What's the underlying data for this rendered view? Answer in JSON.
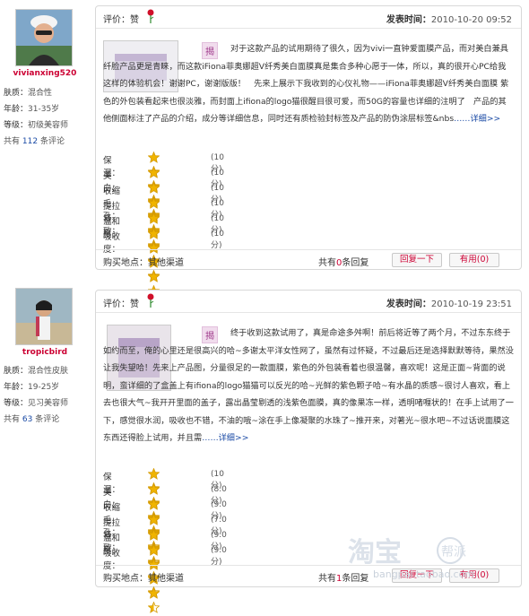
{
  "colors": {
    "accent": "#cc0033",
    "link": "#1a4aa5",
    "star": "#f0b400",
    "tag_bg": "#f1dced"
  },
  "reviews": [
    {
      "user": {
        "name": "vivianxing520",
        "skin_label": "肤质：",
        "skin": "混合性",
        "age_label": "年龄：",
        "age": "31-35岁",
        "level_label": "等级：",
        "level": "初级美容师",
        "count_prefix": "共有",
        "count": "112",
        "count_suffix": "条评论"
      },
      "rating_label": "评价：赞",
      "time_label": "发表时间：",
      "time": "2010-10-20 09:52",
      "tag": "揭",
      "text": "对于这款产品的试用期待了很久，因为vivi一直钟爱面膜产品，而对美白兼具纤脸产品更是青睐，而这款iFiona菲奥娜超V纤秀美白面膜真是集合多种心愿于一体，所以，真的很开心PC给我这样的体验机会！谢谢PC，谢谢版版！　先来上展示下我收到的心仪礼物——iFiona菲奥娜超V纤秀美白面膜 紫色的外包装看起来也很淡雅，而封面上ifiona的logo猫很醒目很可爱，而50G的容量也详细的注明了　产品的其他侧面标注了产品的介绍，成分等详细信息，同时还有质检验封标签及产品的防伪涂层标签&nbs",
      "more": "……详细>>",
      "ratings": [
        {
          "name": "保湿：",
          "stars": 5,
          "score": "(10分)"
        },
        {
          "name": "美白：",
          "stars": 5,
          "score": "(10分)"
        },
        {
          "name": "收缩毛孔：",
          "stars": 5,
          "score": "(10分)"
        },
        {
          "name": "提拉紧致：",
          "stars": 5,
          "score": "(10分)"
        },
        {
          "name": "温和度：",
          "stars": 5,
          "score": "(10分)"
        },
        {
          "name": "吸收度：",
          "stars": 5,
          "score": "(10分)"
        }
      ],
      "buy_place": "购买地点：其他渠道",
      "reply_prefix": "共有",
      "reply_count": "0",
      "reply_suffix": "条回复",
      "reply_btn": "回复一下",
      "useful_btn": "有用(0)"
    },
    {
      "user": {
        "name": "tropicbird",
        "skin_label": "肤质：",
        "skin": "混合性皮肤",
        "age_label": "年龄：",
        "age": "19-25岁",
        "level_label": "等级：",
        "level": "见习美容师",
        "count_prefix": "共有",
        "count": "63",
        "count_suffix": "条评论"
      },
      "rating_label": "评价：赞",
      "time_label": "发表时间：",
      "time": "2010-10-19 23:51",
      "tag": "揭",
      "text": "终于收到这款试用了，真是命途多舛啊！前后将近等了两个月，不过东东终于如约而至，俺的心里还是很高兴的哈~多谢太平洋女性网了，虽然有过怀疑，不过最后还是选择默默等待，果然没让我失望哈！先来上产品图，分量很足的一款面膜，紫色的外包装看着也很温馨，喜欢呢！这是正面~背面的说明，蛮详细的了盒盖上有ifiona的logo猫猫可以反光的哈~光鲜的紫色颗子哈~有水晶的质感~很讨人喜欢，看上去也很大气~我开开里面的盖子，露出晶莹剔透的浅紫色面膜，真的像果冻一样，透明啫喱状的！在手上试用了一下，感觉很水润，吸收也不错，不油的哦~涂在手上像凝聚的水珠了~推开来，对著光~很水吧~不过话说面膜这东西还得脸上试用，并且需",
      "more": "……详细>>",
      "ratings": [
        {
          "name": "保湿：",
          "stars": 5,
          "score": "(10分)"
        },
        {
          "name": "美白：",
          "stars": 4,
          "score": "(8.0分)"
        },
        {
          "name": "收缩毛孔：",
          "stars": 4.5,
          "score": "(9.0分)"
        },
        {
          "name": "提拉紧致：",
          "stars": 3.5,
          "score": "(7.0分)"
        },
        {
          "name": "温和度：",
          "stars": 4.5,
          "score": "(9.0分)"
        },
        {
          "name": "吸收度：",
          "stars": 4.5,
          "score": "(9.0分)"
        }
      ],
      "buy_place": "购买地点：其他渠道",
      "reply_prefix": "共有",
      "reply_count": "1",
      "reply_suffix": "条回复",
      "reply_btn": "回复一下",
      "useful_btn": "有用(0)"
    }
  ],
  "watermark": {
    "brand": "淘宝",
    "suffix": "帮派",
    "domain": "bangpai.taobao.com"
  }
}
